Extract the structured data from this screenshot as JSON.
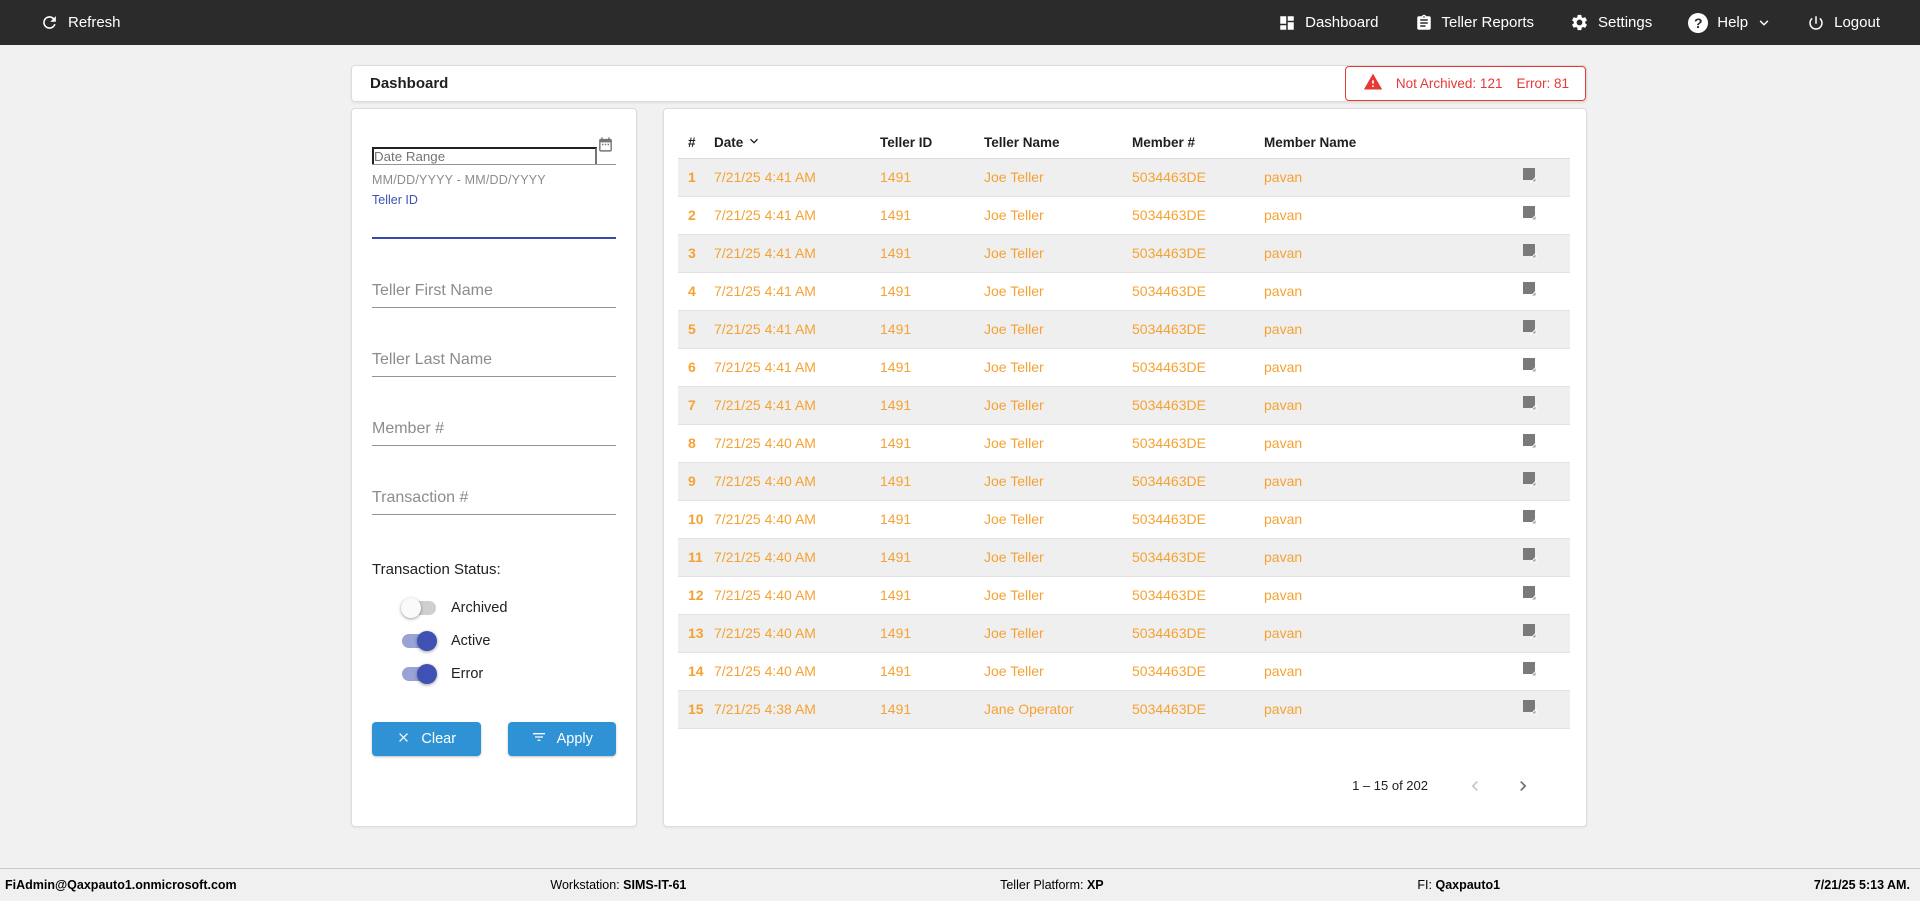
{
  "colors": {
    "nav_bg": "#2b2b2b",
    "accent_blue": "#2e92d4",
    "toggle_indigo": "#3f51b5",
    "row_orange": "#f5a233",
    "alert_red": "#e53935"
  },
  "nav": {
    "refresh_label": "Refresh",
    "items": [
      {
        "label": "Dashboard",
        "icon": "dashboard-icon"
      },
      {
        "label": "Teller Reports",
        "icon": "teller-reports-icon"
      },
      {
        "label": "Settings",
        "icon": "settings-icon"
      },
      {
        "label": "Help",
        "icon": "help-icon"
      },
      {
        "label": "Logout",
        "icon": "logout-icon"
      }
    ]
  },
  "header": {
    "title": "Dashboard",
    "alert": {
      "not_archived": "Not Archived: 121",
      "error": "Error: 81"
    }
  },
  "filters": {
    "date_range_placeholder": "Date Range",
    "date_range_hint": "MM/DD/YYYY - MM/DD/YYYY",
    "teller_id_label": "Teller ID",
    "teller_first_name_placeholder": "Teller First Name",
    "teller_last_name_placeholder": "Teller Last Name",
    "member_number_placeholder": "Member #",
    "transaction_number_placeholder": "Transaction #",
    "status_label": "Transaction Status:",
    "toggles": [
      {
        "label": "Archived",
        "on": false
      },
      {
        "label": "Active",
        "on": true
      },
      {
        "label": "Error",
        "on": true
      }
    ],
    "clear_label": "Clear",
    "apply_label": "Apply"
  },
  "table": {
    "columns": [
      "#",
      "Date",
      "Teller ID",
      "Teller Name",
      "Member #",
      "Member Name"
    ],
    "sorted_column": "Date",
    "rows": [
      {
        "num": "1",
        "date": "7/21/25 4:41 AM",
        "teller_id": "1491",
        "teller_name": "Joe Teller",
        "member_number": "5034463DE",
        "member_name": "pavan"
      },
      {
        "num": "2",
        "date": "7/21/25 4:41 AM",
        "teller_id": "1491",
        "teller_name": "Joe Teller",
        "member_number": "5034463DE",
        "member_name": "pavan"
      },
      {
        "num": "3",
        "date": "7/21/25 4:41 AM",
        "teller_id": "1491",
        "teller_name": "Joe Teller",
        "member_number": "5034463DE",
        "member_name": "pavan"
      },
      {
        "num": "4",
        "date": "7/21/25 4:41 AM",
        "teller_id": "1491",
        "teller_name": "Joe Teller",
        "member_number": "5034463DE",
        "member_name": "pavan"
      },
      {
        "num": "5",
        "date": "7/21/25 4:41 AM",
        "teller_id": "1491",
        "teller_name": "Joe Teller",
        "member_number": "5034463DE",
        "member_name": "pavan"
      },
      {
        "num": "6",
        "date": "7/21/25 4:41 AM",
        "teller_id": "1491",
        "teller_name": "Joe Teller",
        "member_number": "5034463DE",
        "member_name": "pavan"
      },
      {
        "num": "7",
        "date": "7/21/25 4:41 AM",
        "teller_id": "1491",
        "teller_name": "Joe Teller",
        "member_number": "5034463DE",
        "member_name": "pavan"
      },
      {
        "num": "8",
        "date": "7/21/25 4:40 AM",
        "teller_id": "1491",
        "teller_name": "Joe Teller",
        "member_number": "5034463DE",
        "member_name": "pavan"
      },
      {
        "num": "9",
        "date": "7/21/25 4:40 AM",
        "teller_id": "1491",
        "teller_name": "Joe Teller",
        "member_number": "5034463DE",
        "member_name": "pavan"
      },
      {
        "num": "10",
        "date": "7/21/25 4:40 AM",
        "teller_id": "1491",
        "teller_name": "Joe Teller",
        "member_number": "5034463DE",
        "member_name": "pavan"
      },
      {
        "num": "11",
        "date": "7/21/25 4:40 AM",
        "teller_id": "1491",
        "teller_name": "Joe Teller",
        "member_number": "5034463DE",
        "member_name": "pavan"
      },
      {
        "num": "12",
        "date": "7/21/25 4:40 AM",
        "teller_id": "1491",
        "teller_name": "Joe Teller",
        "member_number": "5034463DE",
        "member_name": "pavan"
      },
      {
        "num": "13",
        "date": "7/21/25 4:40 AM",
        "teller_id": "1491",
        "teller_name": "Joe Teller",
        "member_number": "5034463DE",
        "member_name": "pavan"
      },
      {
        "num": "14",
        "date": "7/21/25 4:40 AM",
        "teller_id": "1491",
        "teller_name": "Joe Teller",
        "member_number": "5034463DE",
        "member_name": "pavan"
      },
      {
        "num": "15",
        "date": "7/21/25 4:38 AM",
        "teller_id": "1491",
        "teller_name": "Jane Operator",
        "member_number": "5034463DE",
        "member_name": "pavan"
      }
    ],
    "pagination": {
      "range": "1 – 15 of 202"
    }
  },
  "footer": {
    "user": "FiAdmin@Qaxpauto1.onmicrosoft.com",
    "workstation_label": "Workstation:",
    "workstation_value": "SIMS-IT-61",
    "platform_label": "Teller Platform:",
    "platform_value": "XP",
    "fi_label": "FI:",
    "fi_value": "Qaxpauto1",
    "timestamp": "7/21/25 5:13 AM."
  }
}
